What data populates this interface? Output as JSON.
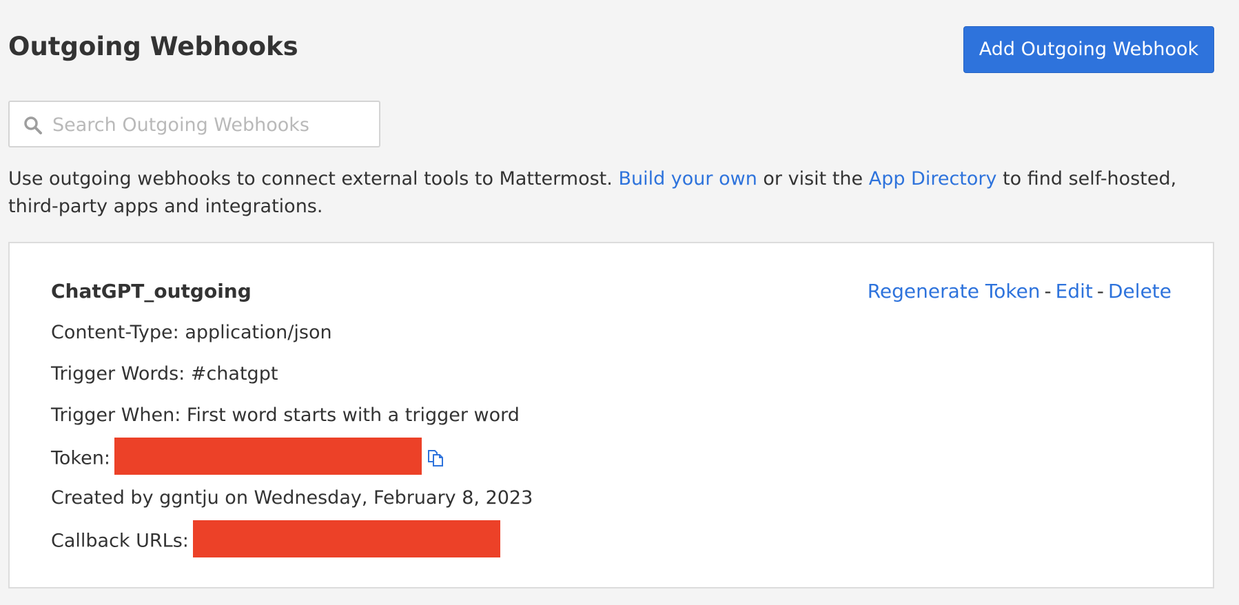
{
  "header": {
    "title": "Outgoing Webhooks",
    "add_button_label": "Add Outgoing Webhook"
  },
  "search": {
    "placeholder": "Search Outgoing Webhooks",
    "value": "",
    "icon": "search-icon"
  },
  "description": {
    "text_before": "Use outgoing webhooks to connect external tools to Mattermost. ",
    "link1": "Build your own",
    "text_middle": " or visit the ",
    "link2": "App Directory",
    "text_after": " to find self-hosted, third-party apps and integrations."
  },
  "webhook": {
    "name": "ChatGPT_outgoing",
    "actions": {
      "regenerate": "Regenerate Token",
      "edit": "Edit",
      "delete": "Delete",
      "separator": "-"
    },
    "content_type": "Content-Type: application/json",
    "trigger_words": "Trigger Words: #chatgpt",
    "trigger_when": "Trigger When: First word starts with a trigger word",
    "token_label": "Token:",
    "created": "Created by ggntju on Wednesday, February 8, 2023",
    "callback_label": "Callback URLs:",
    "copy_icon": "copy-icon"
  },
  "colors": {
    "accent": "#2e73dc",
    "background": "#f4f4f4",
    "redaction": "#ec4128"
  }
}
